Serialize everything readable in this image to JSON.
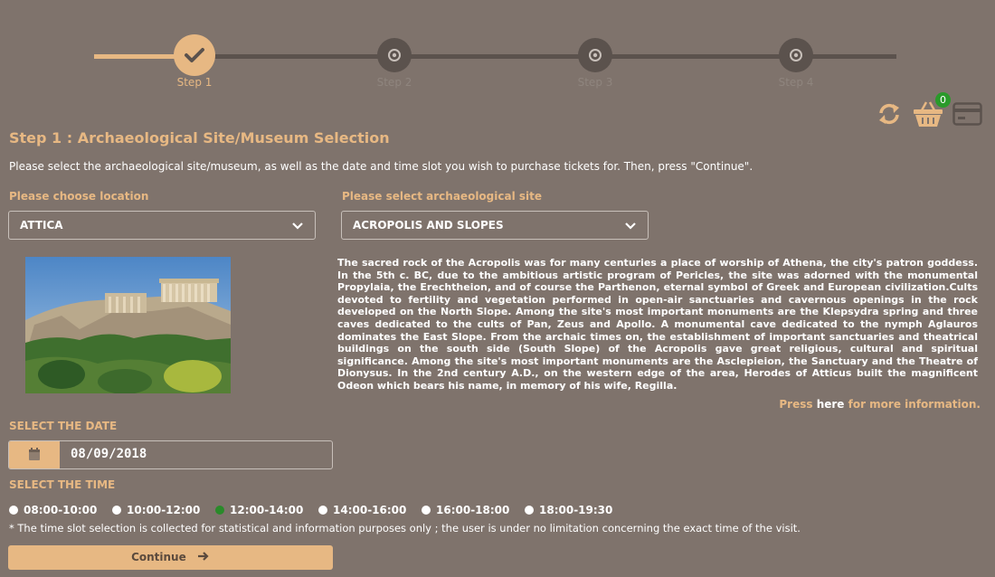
{
  "stepper": {
    "steps": [
      {
        "label": "Step 1",
        "state": "active"
      },
      {
        "label": "Step 2",
        "state": "pending"
      },
      {
        "label": "Step 3",
        "state": "pending"
      },
      {
        "label": "Step 4",
        "state": "pending"
      }
    ]
  },
  "toolbar": {
    "cart_count": "0",
    "icons": [
      "refresh-icon",
      "basket-icon",
      "card-icon"
    ]
  },
  "page": {
    "title": "Step 1 : Archaeological Site/Museum Selection",
    "intro": "Please select the archaeological site/museum, as well as the date and time slot you wish to purchase tickets for. Then, press \"Continue\"."
  },
  "location": {
    "label": "Please choose location",
    "value": "ATTICA"
  },
  "site": {
    "label": "Please select archaeological site",
    "value": "ACROPOLIS AND SLOPES",
    "description": "The sacred rock of the Acropolis was for many centuries a place of worship of Athena, the city's patron goddess. In the 5th c. BC, due to the ambitious artistic program of Pericles, the site was adorned with the monumental Propylaia, the Erechtheion, and of course the Parthenon, eternal symbol of Greek and European civilization.Cults devoted to fertility and vegetation performed in open-air sanctuaries and cavernous openings in the rock developed on the North Slope. Among the site's most important monuments are the Klepsydra spring and three caves dedicated to the cults of Pan, Zeus and Apollo. A monumental cave dedicated to the nymph Aglauros dominates the East Slope. From the archaic times on, the establishment of important sanctuaries and theatrical buildings on the south side (South Slope) of the Acropolis gave great religious, cultural and spiritual significance. Among the site's most important monuments are the Asclepieion, the Sanctuary and the Theatre of Dionysus. In the 2nd century A.D., on the western edge of the area, Herodes of Atticus built the magnificent Odeon which bears his name, in memory of his wife, Regilla.",
    "more_prefix": "Press ",
    "more_link": "here",
    "more_suffix": " for more information."
  },
  "date": {
    "label": "SELECT THE DATE",
    "value": "08/09/2018"
  },
  "time": {
    "label": "SELECT THE TIME",
    "slots": [
      {
        "label": "08:00-10:00",
        "checked": false
      },
      {
        "label": "10:00-12:00",
        "checked": false
      },
      {
        "label": "12:00-14:00",
        "checked": true
      },
      {
        "label": "14:00-16:00",
        "checked": false
      },
      {
        "label": "16:00-18:00",
        "checked": false
      },
      {
        "label": "18:00-19:30",
        "checked": false
      }
    ],
    "note": "* The time slot selection is collected for statistical and information purposes only ; the user is under no limitation concerning the exact time of the visit."
  },
  "continue_label": "Continue",
  "colors": {
    "background": "#7f736c",
    "accent": "#e7b883",
    "dark": "#5b524d",
    "selected": "#2a8a2a"
  }
}
